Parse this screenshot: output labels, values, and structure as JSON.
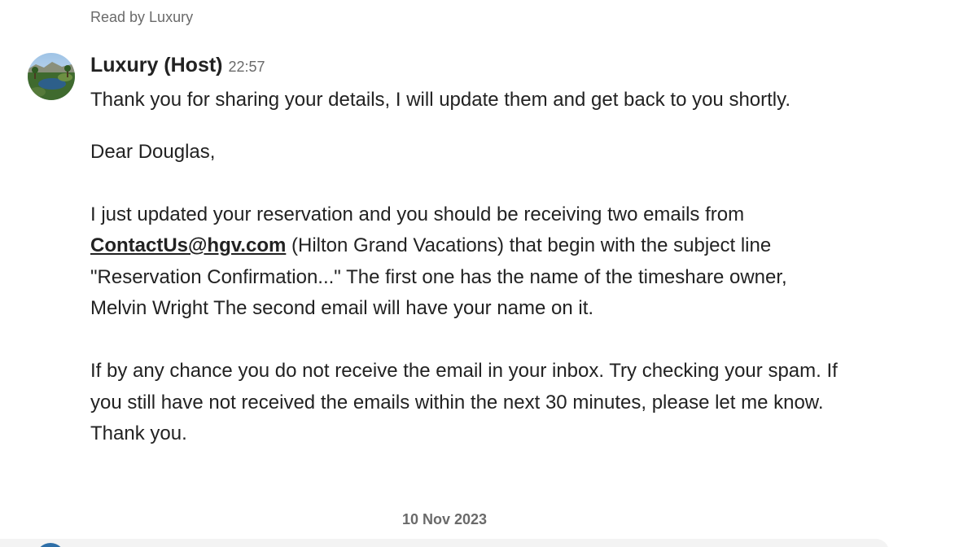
{
  "read_receipt": "Read by Luxury",
  "message": {
    "sender": "Luxury (Host)",
    "time": "22:57",
    "line1": "Thank you for sharing your details, I will update them and get back to you shortly.",
    "greeting": "Dear Douglas,",
    "para1_prefix": "I just updated your reservation and you should be receiving two emails from",
    "email_link": "ContactUs@hgv.com",
    "para1_suffix": "(Hilton Grand Vacations) that begin with the subject line \"Reservation Confirmation...\" The first one has the name of the timeshare owner, Melvin Wright The second email will have your name on it.",
    "para2": "If by any chance you do not receive the email in your inbox. Try checking your spam. If you still have not received the emails within the next 30 minutes, please let me know. Thank you."
  },
  "date_separator": "10 Nov 2023",
  "colors": {
    "text": "#222222",
    "muted": "#6a6a6a",
    "background": "#ffffff"
  }
}
